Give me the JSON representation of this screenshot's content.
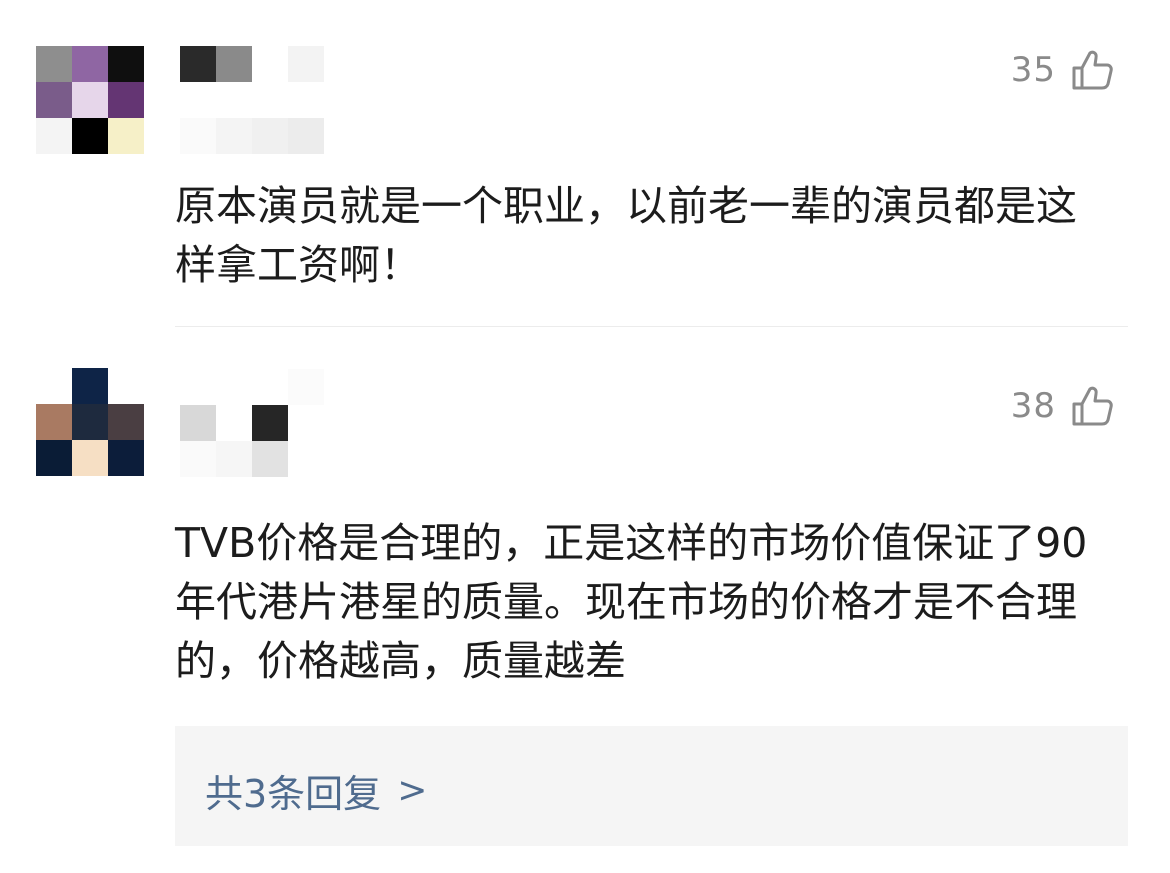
{
  "comments": [
    {
      "likes": "35",
      "text": "原本演员就是一个职业，以前老一辈的演员都是这样拿工资啊！",
      "avatar_icon": "pixelated-avatar",
      "username_icon": "pixelated-username"
    },
    {
      "likes": "38",
      "text": "TVB价格是合理的，正是这样的市场价值保证了90年代港片港星的质量。现在市场的价格才是不合理的，价格越高，质量越差",
      "avatar_icon": "pixelated-avatar",
      "username_icon": "pixelated-username"
    }
  ],
  "replies": {
    "label": "共3条回复",
    "chevron": ">"
  },
  "colors": {
    "link": "#4f6b8e",
    "like_count": "#8a8a8a",
    "reply_bg": "#f5f5f5"
  }
}
